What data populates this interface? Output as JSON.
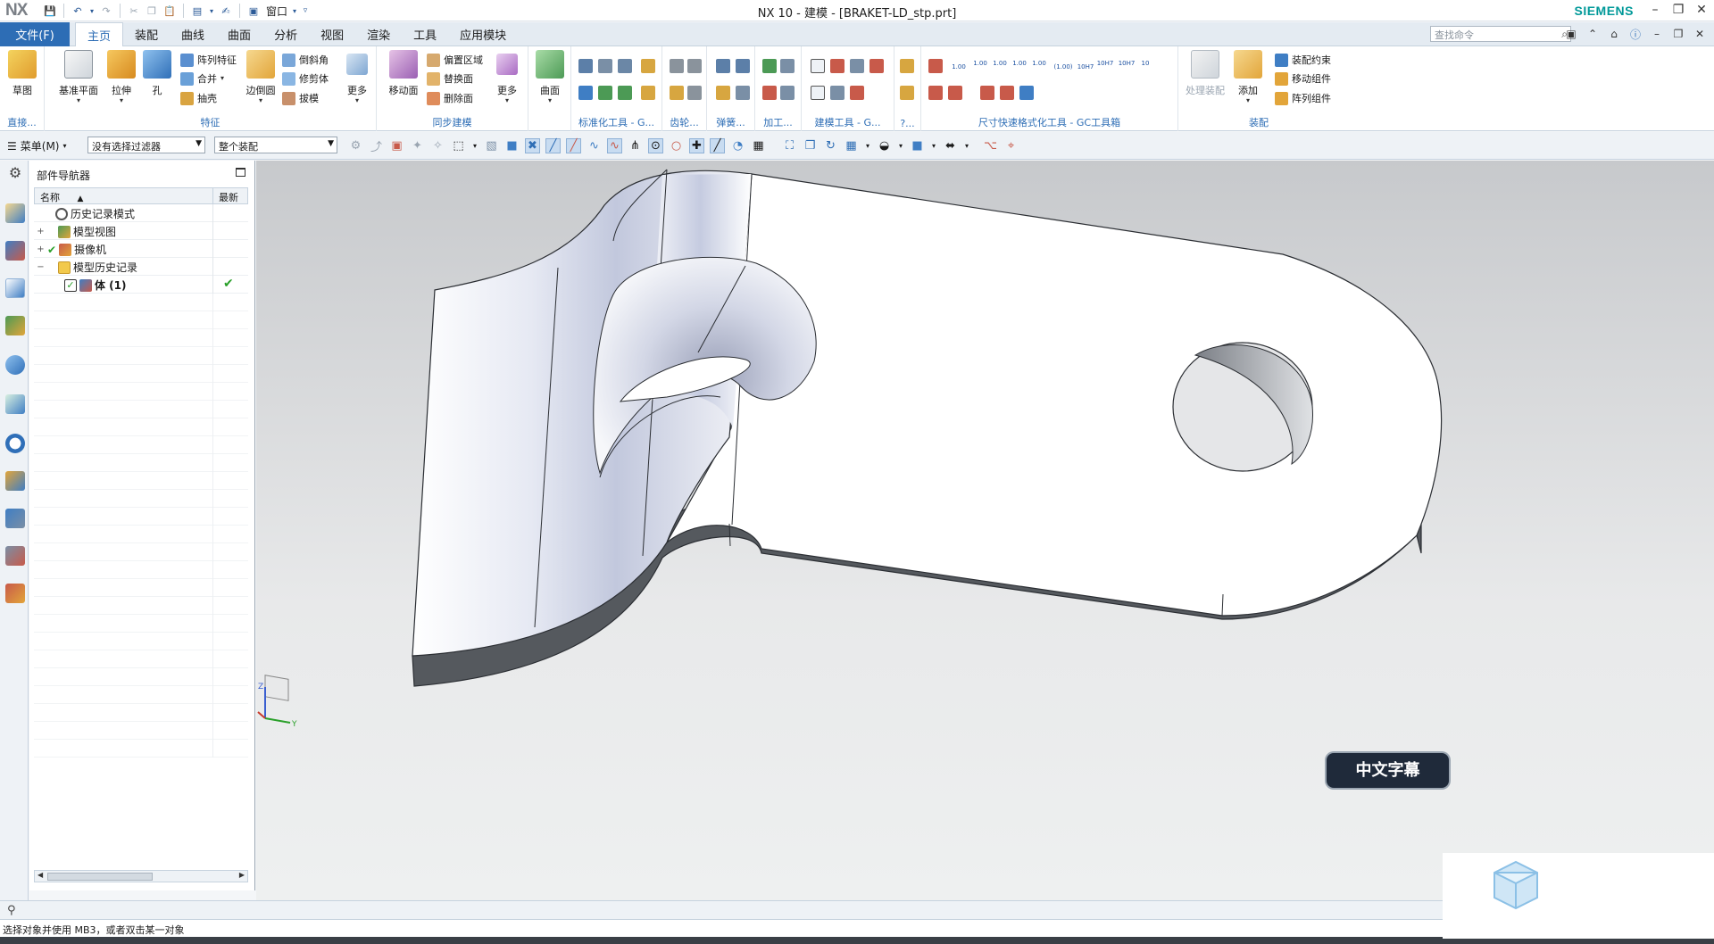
{
  "app": {
    "logo": "NX",
    "title": "NX 10 - 建模 - [BRAKET-LD_stp.prt]",
    "brand": "SIEMENS",
    "window_label": "窗口"
  },
  "menu": {
    "file": "文件(F)",
    "tabs": [
      "主页",
      "装配",
      "曲线",
      "曲面",
      "分析",
      "视图",
      "渲染",
      "工具",
      "应用模块"
    ],
    "search_placeholder": "查找命令"
  },
  "ribbon": {
    "direct_sketch": {
      "label": "草图",
      "group": "直接..."
    },
    "feature": {
      "group": "特征",
      "datum_plane": "基准平面",
      "extrude": "拉伸",
      "hole": "孔",
      "pattern_feature": "阵列特征",
      "unite": "合并",
      "shell": "抽壳",
      "edge_blend": "边倒圆",
      "chamfer": "倒斜角",
      "trim_body": "修剪体",
      "draft": "拔模",
      "more": "更多"
    },
    "sync": {
      "group": "同步建模",
      "move_face": "移动面",
      "offset_region": "偏置区域",
      "replace_face": "替换面",
      "delete_face": "删除面",
      "more": "更多"
    },
    "surface": {
      "label": "曲面"
    },
    "groups_misc": {
      "std_tools": "标准化工具 - G...",
      "gear": "齿轮...",
      "spring": "弹簧...",
      "process": "加工...",
      "modeling_tools": "建模工具 - G...",
      "q": "?...",
      "dim_tools": "尺寸快速格式化工具 - GC工具箱",
      "assembly": "装配"
    },
    "dim_labels": [
      "1.00",
      "1.00",
      "1.00",
      "1.00",
      "1.00",
      "(1.00)",
      "10H7",
      "10H7",
      "10H7",
      "10"
    ],
    "assembly": {
      "process_assembly": "处理装配",
      "add": "添加",
      "assembly_constraint": "装配约束",
      "move_component": "移动组件",
      "pattern_component": "阵列组件"
    }
  },
  "toolbar2": {
    "menu": "菜单(M)",
    "filter": "没有选择过滤器",
    "scope": "整个装配"
  },
  "navigator": {
    "title": "部件导航器",
    "col_name": "名称",
    "col_new": "最新",
    "rows": [
      {
        "label": "历史记录模式"
      },
      {
        "label": "模型视图"
      },
      {
        "label": "摄像机"
      },
      {
        "label": "模型历史记录"
      },
      {
        "label": "体 (1)"
      }
    ]
  },
  "triad": {
    "z": "Z",
    "y": "Y"
  },
  "status": {
    "prompt": "选择对象并使用 MB3，或者双击某一对象"
  },
  "watermark": {
    "badge_text": "中文字幕"
  },
  "colors": {
    "accent": "#2d6db5",
    "brand": "#009999",
    "model_face": "#ffffff",
    "model_side": "#55595e"
  }
}
